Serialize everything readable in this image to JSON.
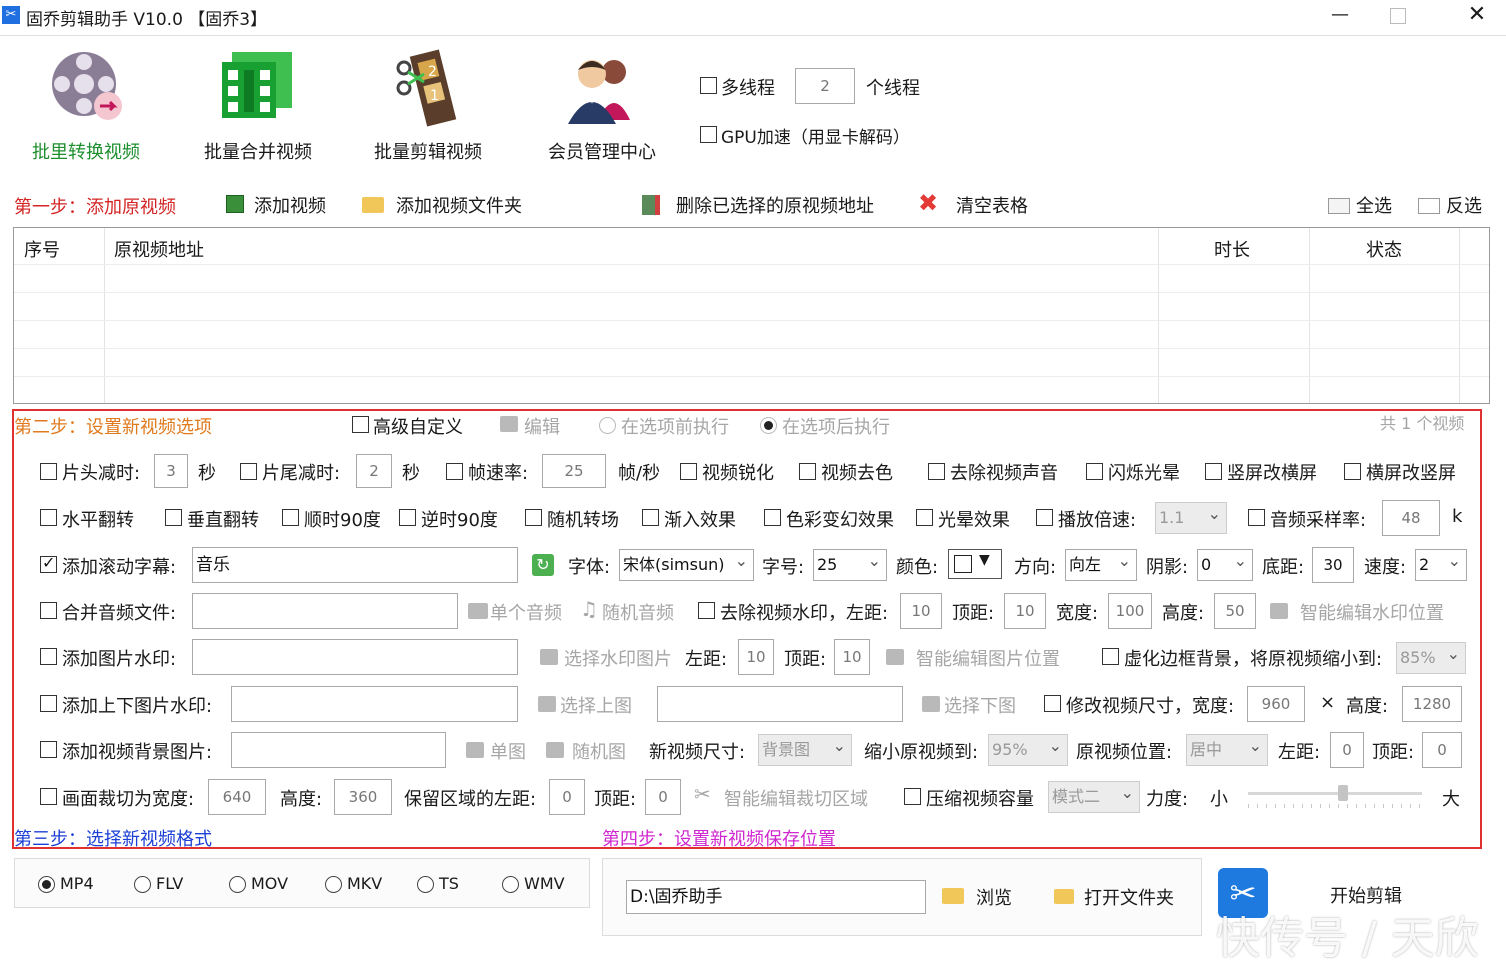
{
  "window": {
    "title": "固乔剪辑助手 V10.0 【固乔3】"
  },
  "toolbar": {
    "convert_label": "批里转换视频",
    "merge_label": "批量合并视频",
    "cut_label": "批量剪辑视频",
    "member_label": "会员管理中心",
    "multithread_label": "多线程",
    "thread_count": "2",
    "threads_unit": "个线程",
    "gpu_label": "GPU加速（用显卡解码）"
  },
  "step1": {
    "title": "第一步：添加原视频",
    "add_video": "添加视频",
    "add_folder": "添加视频文件夹",
    "delete_selected": "删除已选择的原视频地址",
    "clear_table": "清空表格",
    "select_all": "全选",
    "invert": "反选"
  },
  "table": {
    "columns": [
      "序号",
      "原视频地址",
      "时长",
      "状态"
    ]
  },
  "step2": {
    "title": "第二步：设置新视频选项",
    "advanced": "高级自定义",
    "edit": "编辑",
    "before": "在选项前执行",
    "after": "在选项后执行",
    "count": "共 1 个视频",
    "row1": {
      "head_cut": "片头减时:",
      "head_val": "3",
      "sec": "秒",
      "tail_cut": "片尾减时:",
      "tail_val": "2",
      "fps": "帧速率:",
      "fps_val": "25",
      "fps_unit": "帧/秒",
      "sharpen": "视频锐化",
      "decolor": "视频去色",
      "mute": "去除视频声音",
      "flash": "闪烁光晕",
      "v2h": "竖屏改横屏",
      "h2v": "横屏改竖屏"
    },
    "row2": {
      "hflip": "水平翻转",
      "vflip": "垂直翻转",
      "cw90": "顺时90度",
      "ccw90": "逆时90度",
      "random_trans": "随机转场",
      "fade_in": "渐入效果",
      "color_fx": "色彩变幻效果",
      "halo": "光晕效果",
      "speed_label": "播放倍速:",
      "speed_val": "1.1",
      "sample_label": "音频采样率:",
      "sample_val": "48",
      "sample_unit": "k"
    },
    "row3": {
      "subtitle_label": "添加滚动字幕:",
      "subtitle_text": "音乐",
      "font_label": "字体:",
      "font_val": "宋体(simsun)",
      "size_label": "字号:",
      "size_val": "25",
      "color_label": "颜色:",
      "dir_label": "方向:",
      "dir_val": "向左",
      "shadow_label": "阴影:",
      "shadow_val": "0",
      "bottom_label": "底距:",
      "bottom_val": "30",
      "speed_label": "速度:",
      "speed_val": "2"
    },
    "row4": {
      "merge_audio": "合并音频文件:",
      "single_audio": "单个音频",
      "random_audio": "随机音频",
      "remove_wm": "去除视频水印，左距:",
      "left_val": "10",
      "top_label": "顶距:",
      "top_val": "10",
      "width_label": "宽度:",
      "width_val": "100",
      "height_label": "高度:",
      "height_val": "50",
      "smart_wm": "智能编辑水印位置"
    },
    "row5": {
      "img_wm": "添加图片水印:",
      "choose_wm": "选择水印图片",
      "left_label": "左距:",
      "left_val": "10",
      "top_label": "顶距:",
      "top_val": "10",
      "smart_img": "智能编辑图片位置",
      "blur_bg": "虚化边框背景，将原视频缩小到:",
      "blur_val": "85%"
    },
    "row6": {
      "tb_wm": "添加上下图片水印:",
      "choose_top": "选择上图",
      "choose_bottom": "选择下图",
      "resize": "修改视频尺寸，宽度:",
      "width_val": "960",
      "x": "×",
      "height_label": "高度:",
      "height_val": "1280"
    },
    "row7": {
      "bg_img": "添加视频背景图片:",
      "single_img": "单图",
      "random_img": "随机图",
      "new_size": "新视频尺寸:",
      "new_size_val": "背景图",
      "shrink": "缩小原视频到:",
      "shrink_val": "95%",
      "pos_label": "原视频位置:",
      "pos_val": "居中",
      "left_label": "左距:",
      "left_val": "0",
      "top_label": "顶距:",
      "top_val": "0"
    },
    "row8": {
      "crop": "画面裁切为宽度:",
      "crop_w": "640",
      "height_label": "高度:",
      "crop_h": "360",
      "keep_left": "保留区域的左距:",
      "keep_left_val": "0",
      "top_label": "顶距:",
      "top_val": "0",
      "smart_crop": "智能编辑裁切区域",
      "compress": "压缩视频容量",
      "mode_val": "模式二",
      "force": "力度:",
      "small": "小",
      "big": "大",
      "force_level": 0.55
    }
  },
  "step3": {
    "title": "第三步：选择新视频格式",
    "formats": [
      "MP4",
      "FLV",
      "MOV",
      "MKV",
      "TS",
      "WMV"
    ],
    "selected": "MP4"
  },
  "step4": {
    "title": "第四步：设置新视频保存位置",
    "path": "D:\\固乔助手",
    "browse": "浏览",
    "open_folder": "打开文件夹",
    "start": "开始剪辑"
  },
  "watermark": "快传号 / 天欣",
  "colors": {
    "red": "#d42424",
    "green": "#1e8f2e",
    "blue": "#1c3fd6",
    "magenta": "#d028d0",
    "border_red": "#e03030"
  }
}
